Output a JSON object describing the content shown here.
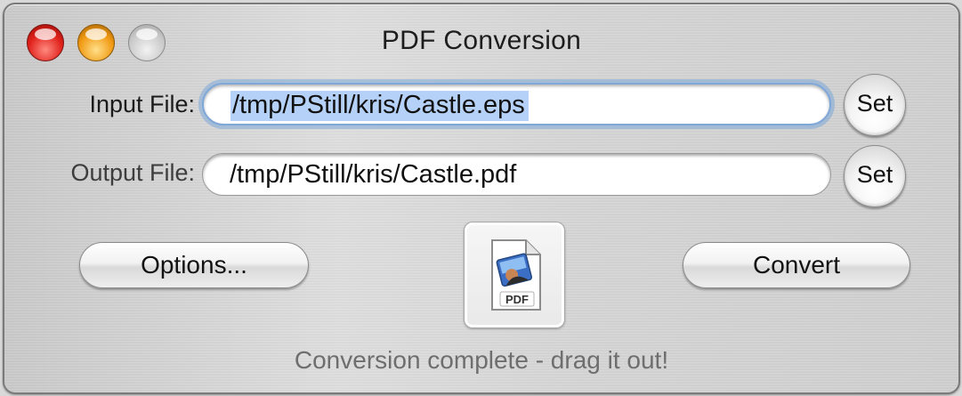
{
  "window": {
    "title": "PDF Conversion"
  },
  "input": {
    "label": "Input File:",
    "value": "/tmp/PStill/kris/Castle.eps",
    "set_label": "Set"
  },
  "output": {
    "label": "Output File:",
    "value": "/tmp/PStill/kris/Castle.pdf",
    "set_label": "Set"
  },
  "buttons": {
    "options_label": "Options...",
    "convert_label": "Convert"
  },
  "document_icon": {
    "icon": "pdf-document-icon",
    "badge": "PDF"
  },
  "status": {
    "text": "Conversion complete - drag it out!"
  },
  "colors": {
    "selection": "#b5d1f7",
    "focus_ring": "#7fa7d8",
    "close": "#e0211b",
    "minimize": "#f19a14"
  }
}
